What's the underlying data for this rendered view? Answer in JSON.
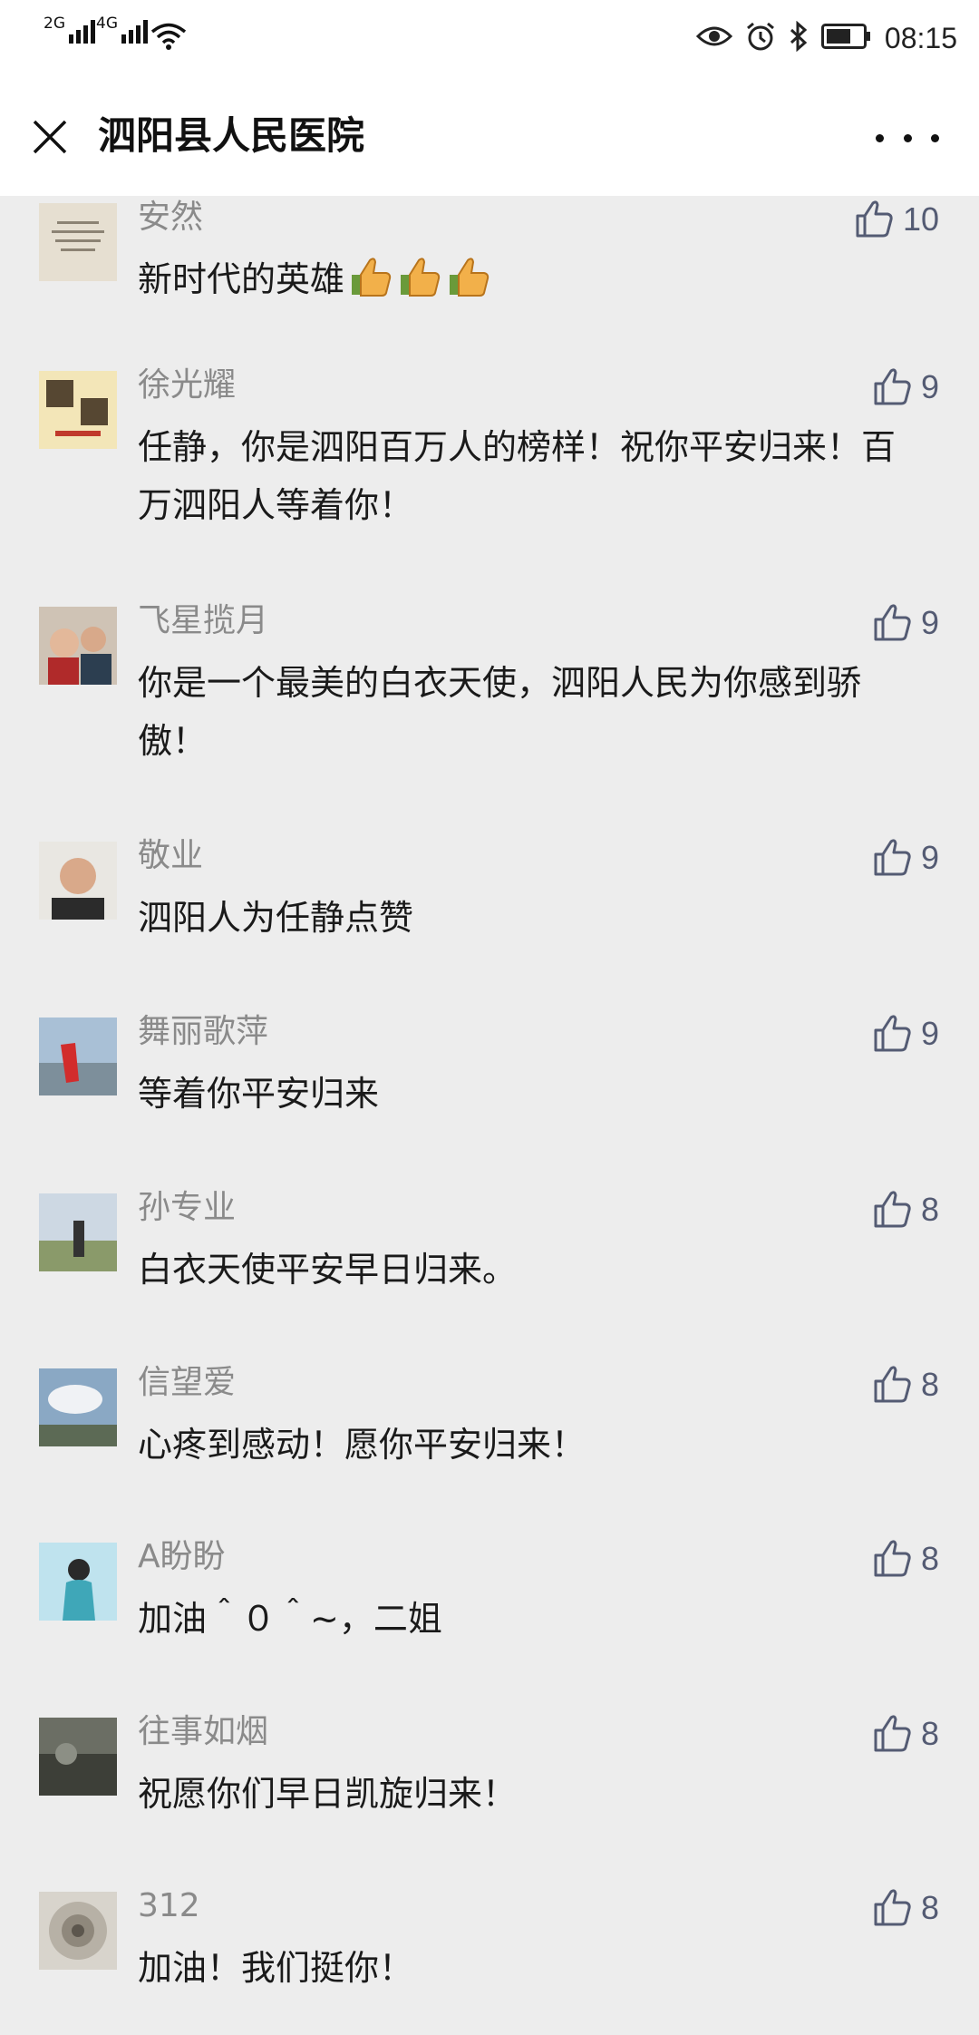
{
  "status_bar": {
    "signal_1_label": "2G",
    "signal_2_label": "4G",
    "time": "08:15",
    "icons": [
      "eye-icon",
      "alarm-icon",
      "bluetooth-icon",
      "battery-icon",
      "wifi-icon",
      "signal-icon"
    ]
  },
  "nav": {
    "title": "泗阳县人民医院",
    "close_icon": "close-icon",
    "more_icon": "more-icon"
  },
  "comments": [
    {
      "name": "安然",
      "text": "新时代的英雄",
      "emoji_count": 3,
      "likes": "10"
    },
    {
      "name": "徐光耀",
      "text": "任静，你是泗阳百万人的榜样！祝你平安归来！百万泗阳人等着你！",
      "likes": "9"
    },
    {
      "name": "飞星揽月",
      "text": "你是一个最美的白衣天使，泗阳人民为你感到骄傲！",
      "likes": "9"
    },
    {
      "name": "敬业",
      "text": "泗阳人为任静点赞",
      "likes": "9"
    },
    {
      "name": "舞丽歌萍",
      "text": "等着你平安归来",
      "likes": "9"
    },
    {
      "name": "孙专业",
      "text": "白衣天使平安早日归来。",
      "likes": "8"
    },
    {
      "name": "信望爱",
      "text": "心疼到感动！愿你平安归来！",
      "likes": "8"
    },
    {
      "name": "A盼盼",
      "text": "加油＾０＾~，二姐",
      "likes": "8"
    },
    {
      "name": "往事如烟",
      "text": "祝愿你们早日凯旋归来！",
      "likes": "8"
    },
    {
      "name": "312",
      "text": "加油！我们挺你！",
      "likes": "8"
    }
  ],
  "colors": {
    "background": "#ededed",
    "nickname": "#8a8a8a",
    "text": "#1a1a1a",
    "like": "#545b73",
    "header": "#ffffff"
  }
}
